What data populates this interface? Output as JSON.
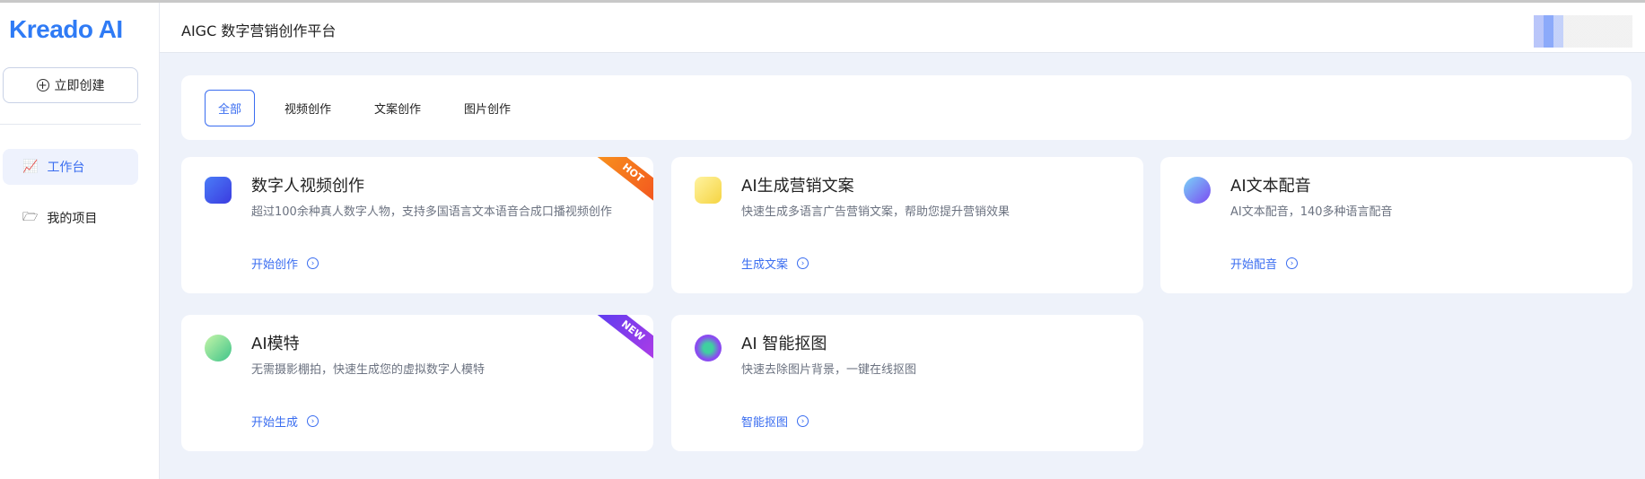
{
  "logo": "Kreado AI",
  "sidebar": {
    "create_label": "立即创建",
    "items": [
      {
        "label": "工作台"
      },
      {
        "label": "我的项目"
      }
    ]
  },
  "header": {
    "title": "AIGC 数字营销创作平台"
  },
  "tabs": [
    {
      "label": "全部"
    },
    {
      "label": "视频创作"
    },
    {
      "label": "文案创作"
    },
    {
      "label": "图片创作"
    }
  ],
  "cards": [
    {
      "title": "数字人视频创作",
      "desc": "超过100余种真人数字人物，支持多国语言文本语音合成口播视频创作",
      "link": "开始创作",
      "badge": "HOT"
    },
    {
      "title": "AI生成营销文案",
      "desc": "快速生成多语言广告营销文案，帮助您提升营销效果",
      "link": "生成文案"
    },
    {
      "title": "AI文本配音",
      "desc": "AI文本配音，140多种语言配音",
      "link": "开始配音"
    },
    {
      "title": "AI模特",
      "desc": "无需摄影棚拍，快速生成您的虚拟数字人模特",
      "link": "开始生成",
      "badge": "NEW"
    },
    {
      "title": "AI 智能抠图",
      "desc": "快速去除图片背景，一键在线抠图",
      "link": "智能抠图"
    }
  ],
  "colors": {
    "accent": "#3a6df0",
    "hot": "#f46a1f",
    "new": "#8b3cf0"
  }
}
